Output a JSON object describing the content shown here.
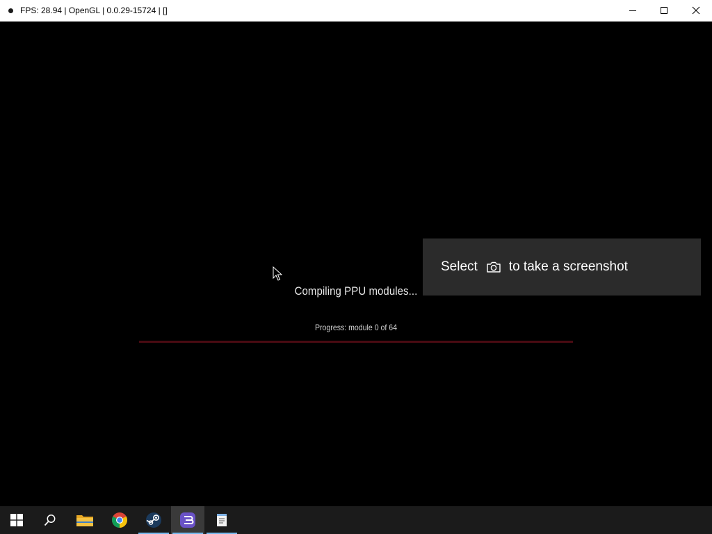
{
  "window": {
    "title": "FPS: 28.94 | OpenGL | 0.0.29-15724 |  []",
    "controls": [
      "minimize",
      "maximize",
      "close"
    ]
  },
  "game": {
    "compile_title": "Compiling PPU modules...",
    "progress_text": "Progress: module 0 of 64",
    "progress": {
      "current": 0,
      "total": 64
    }
  },
  "toast": {
    "select_label": "Select",
    "action_label": "to take a screenshot",
    "icon": "camera-icon"
  },
  "taskbar": {
    "items": [
      {
        "name": "start",
        "icon": "windows-start-icon"
      },
      {
        "name": "search",
        "icon": "search-icon"
      },
      {
        "name": "file-explorer",
        "icon": "folder-icon"
      },
      {
        "name": "chrome",
        "icon": "chrome-icon"
      },
      {
        "name": "steam",
        "icon": "steam-icon",
        "running": true
      },
      {
        "name": "rpcs3",
        "icon": "rpcs3-icon",
        "running": true,
        "active": true
      },
      {
        "name": "notepad",
        "icon": "notepad-icon",
        "running": true
      }
    ]
  },
  "colors": {
    "progress_track": "#4a0b12",
    "toast_bg": "#2b2b2b",
    "taskbar_bg": "#1b1b1b",
    "running_indicator": "#76b9ed"
  }
}
